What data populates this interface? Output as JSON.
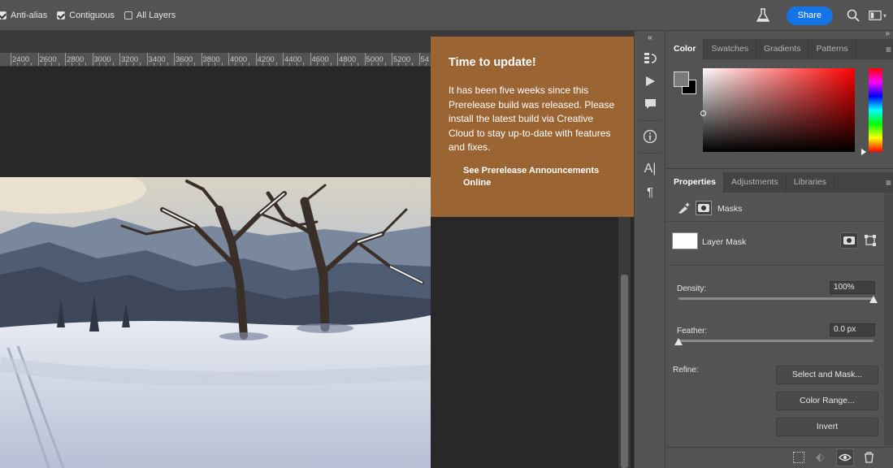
{
  "options_bar": {
    "checkboxes": [
      {
        "label": "Anti-alias",
        "checked": true
      },
      {
        "label": "Contiguous",
        "checked": true
      },
      {
        "label": "All Layers",
        "checked": false
      }
    ],
    "share_label": "Share"
  },
  "ruler": {
    "labels": [
      "2400",
      "2600",
      "2800",
      "3000",
      "3200",
      "3400",
      "3600",
      "3800",
      "4000",
      "4200",
      "4400",
      "4600",
      "4800",
      "5000",
      "5200",
      "54"
    ]
  },
  "popup": {
    "title": "Time to update!",
    "body": "It has been five weeks since this Prerelease build was released. Please install the latest build via Creative Cloud to stay up-to-date with features and fixes.",
    "link": "See Prerelease Announcements Online",
    "color": "#9a6433"
  },
  "color_panel": {
    "tabs": [
      "Color",
      "Swatches",
      "Gradients",
      "Patterns"
    ],
    "active_tab": "Color",
    "foreground": "#7a7a7a",
    "background": "#000000"
  },
  "properties_panel": {
    "tabs": [
      "Properties",
      "Adjustments",
      "Libraries"
    ],
    "active_tab": "Properties",
    "masks_label": "Masks",
    "layer_mask_label": "Layer Mask",
    "density_label": "Density:",
    "density_value": "100%",
    "density_fraction": 1.0,
    "feather_label": "Feather:",
    "feather_value": "0.0 px",
    "feather_fraction": 0.0,
    "refine_label": "Refine:",
    "select_and_mask_label": "Select and Mask...",
    "color_range_label": "Color Range...",
    "invert_label": "Invert"
  },
  "colors": {
    "accent": "#1473e6",
    "panel_bg": "#535353",
    "canvas_bg": "#282828"
  }
}
